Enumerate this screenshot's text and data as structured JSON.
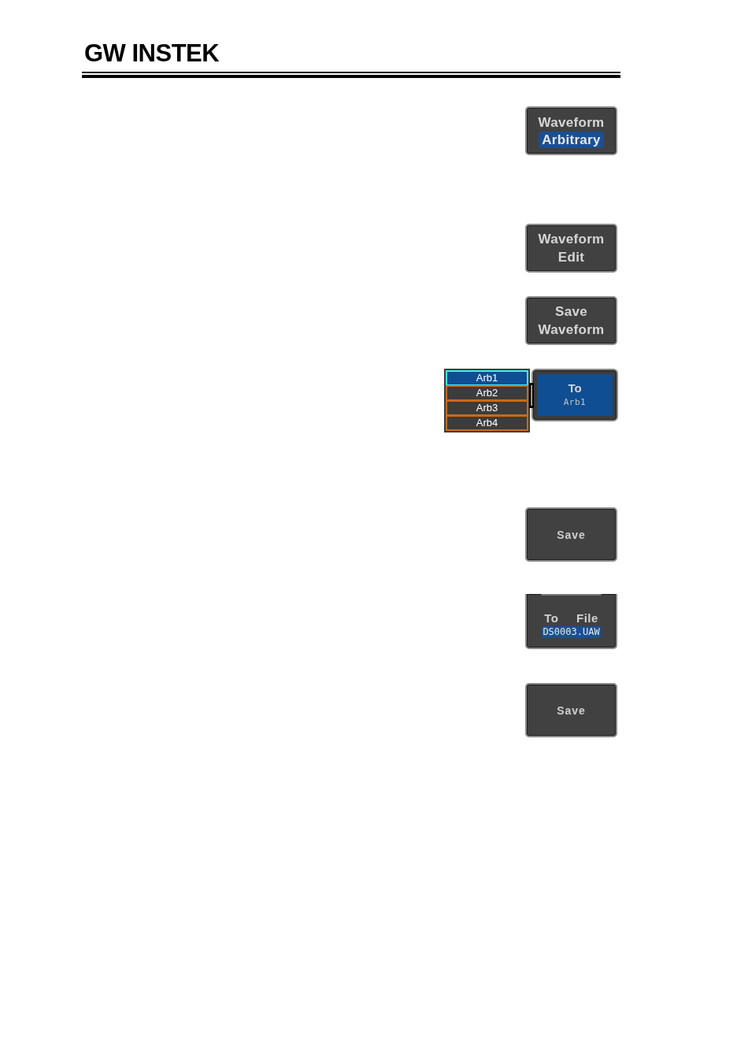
{
  "header": {
    "logo": "GW INSTEK"
  },
  "softkeys": [
    {
      "kind": "menu",
      "lines": [
        "Waveform"
      ],
      "value": "Arbitrary"
    },
    {
      "kind": "menu",
      "lines": [
        "Waveform",
        "Edit"
      ]
    },
    {
      "kind": "menu",
      "lines": [
        "Save",
        "Waveform"
      ]
    },
    {
      "kind": "selector",
      "options": [
        {
          "label": "Arb1",
          "selected": true
        },
        {
          "label": "Arb2",
          "selected": false
        },
        {
          "label": "Arb3",
          "selected": false
        },
        {
          "label": "Arb4",
          "selected": false
        }
      ],
      "lines": [
        "To"
      ],
      "value": "Arb1",
      "active": true
    },
    {
      "kind": "action",
      "lines": [
        "Save"
      ]
    },
    {
      "kind": "file",
      "lines": [
        "To File"
      ],
      "value": "DS0003.UAW"
    },
    {
      "kind": "action",
      "lines": [
        "Save"
      ]
    }
  ]
}
